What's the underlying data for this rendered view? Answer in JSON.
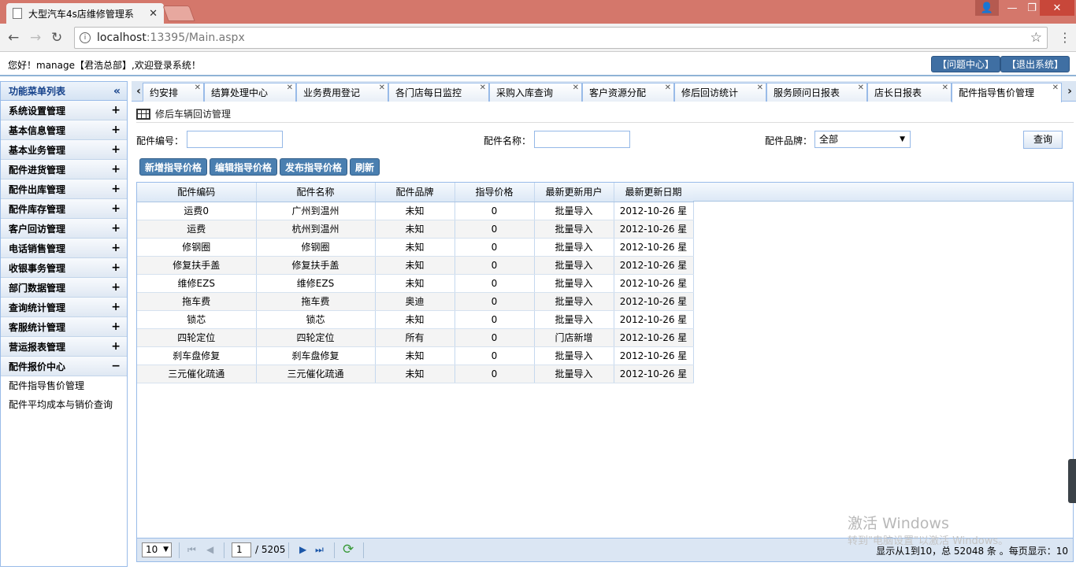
{
  "browser": {
    "tab_title": "大型汽车4s店维修管理系",
    "url_host": "localhost",
    "url_rest": ":13395/Main.aspx"
  },
  "header": {
    "welcome": "您好！manage【君浩总部】,欢迎登录系统！",
    "btn_help": "【问题中心】",
    "btn_logout": "【退出系统】"
  },
  "sidebar": {
    "title": "功能菜单列表",
    "groups": [
      {
        "label": "系统设置管理",
        "toggle": "+"
      },
      {
        "label": "基本信息管理",
        "toggle": "+"
      },
      {
        "label": "基本业务管理",
        "toggle": "+"
      },
      {
        "label": "配件进货管理",
        "toggle": "+"
      },
      {
        "label": "配件出库管理",
        "toggle": "+"
      },
      {
        "label": "配件库存管理",
        "toggle": "+"
      },
      {
        "label": "客户回访管理",
        "toggle": "+"
      },
      {
        "label": "电话销售管理",
        "toggle": "+"
      },
      {
        "label": "收银事务管理",
        "toggle": "+"
      },
      {
        "label": "部门数据管理",
        "toggle": "+"
      },
      {
        "label": "查询统计管理",
        "toggle": "+"
      },
      {
        "label": "客服统计管理",
        "toggle": "+"
      },
      {
        "label": "营运报表管理",
        "toggle": "+"
      },
      {
        "label": "配件报价中心",
        "toggle": "−"
      }
    ],
    "sub_items": [
      "配件指导售价管理",
      "配件平均成本与销价查询"
    ]
  },
  "tabs": [
    "约安排",
    "结算处理中心",
    "业务费用登记",
    "各门店每日监控",
    "采购入库查询",
    "客户资源分配",
    "修后回访统计",
    "服务顾问日报表",
    "店长日报表",
    "配件指导售价管理"
  ],
  "panel": {
    "title": "修后车辆回访管理"
  },
  "search": {
    "code_label": "配件编号：",
    "code_value": "",
    "name_label": "配件名称：",
    "name_value": "",
    "brand_label": "配件品牌：",
    "brand_value": "全部",
    "query_btn": "查询"
  },
  "actions": [
    "新增指导价格",
    "编辑指导价格",
    "发布指导价格",
    "刷新"
  ],
  "grid": {
    "columns": [
      "配件编码",
      "配件名称",
      "配件品牌",
      "指导价格",
      "最新更新用户",
      "最新更新日期"
    ],
    "rows": [
      [
        "运费0",
        "广州到温州",
        "未知",
        "0",
        "批量导入",
        "2012-10-26 星"
      ],
      [
        "运费",
        "杭州到温州",
        "未知",
        "0",
        "批量导入",
        "2012-10-26 星"
      ],
      [
        "修钢圈",
        "修钢圈",
        "未知",
        "0",
        "批量导入",
        "2012-10-26 星"
      ],
      [
        "修复扶手盖",
        "修复扶手盖",
        "未知",
        "0",
        "批量导入",
        "2012-10-26 星"
      ],
      [
        "维修EZS",
        "维修EZS",
        "未知",
        "0",
        "批量导入",
        "2012-10-26 星"
      ],
      [
        "拖车费",
        "拖车费",
        "奥迪",
        "0",
        "批量导入",
        "2012-10-26 星"
      ],
      [
        "锁芯",
        "锁芯",
        "未知",
        "0",
        "批量导入",
        "2012-10-26 星"
      ],
      [
        "四轮定位",
        "四轮定位",
        "所有",
        "0",
        "门店新增",
        "2012-10-26 星"
      ],
      [
        "刹车盘修复",
        "刹车盘修复",
        "未知",
        "0",
        "批量导入",
        "2012-10-26 星"
      ],
      [
        "三元催化疏通",
        "三元催化疏通",
        "未知",
        "0",
        "批量导入",
        "2012-10-26 星"
      ]
    ]
  },
  "pager": {
    "page_size": "10",
    "page": "1",
    "total_pages": "/ 5205",
    "info": "显示从1到10，总 52048 条 。每页显示：10"
  },
  "watermark": {
    "line1": "激活 Windows",
    "line2": "转到\"电脑设置\"以激活 Windows。"
  }
}
